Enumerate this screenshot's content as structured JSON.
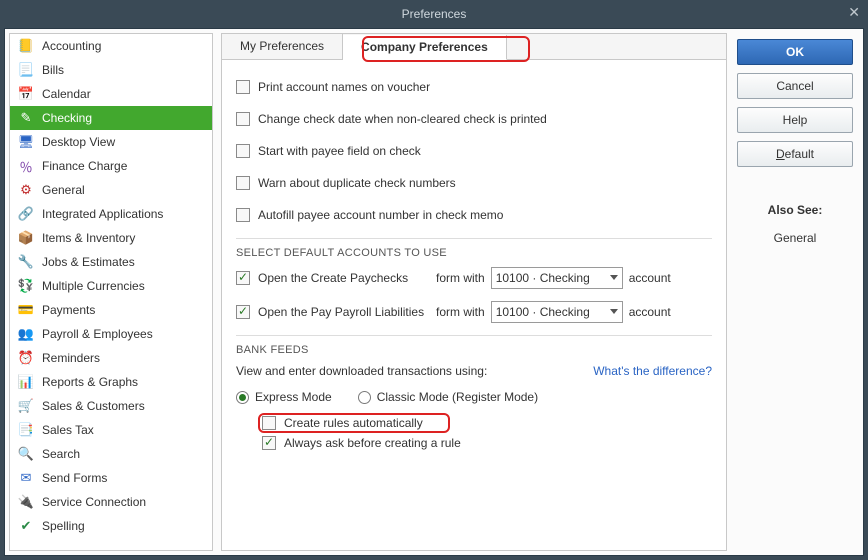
{
  "window_title": "Preferences",
  "sidebar": {
    "items": [
      {
        "label": "Accounting",
        "icon": "📒",
        "color": "#d08a1a"
      },
      {
        "label": "Bills",
        "icon": "📃",
        "color": "#2a64c4"
      },
      {
        "label": "Calendar",
        "icon": "📅",
        "color": "#2a64c4"
      },
      {
        "label": "Checking",
        "icon": "✎",
        "color": "#ffffff",
        "selected": true
      },
      {
        "label": "Desktop View",
        "icon": "🖥",
        "color": "#2a64c4"
      },
      {
        "label": "Finance Charge",
        "icon": "％",
        "color": "#7a3ea6"
      },
      {
        "label": "General",
        "icon": "⚙",
        "color": "#c02a2a"
      },
      {
        "label": "Integrated Applications",
        "icon": "🔗",
        "color": "#3a7aa6"
      },
      {
        "label": "Items & Inventory",
        "icon": "📦",
        "color": "#c28a2a"
      },
      {
        "label": "Jobs & Estimates",
        "icon": "🔧",
        "color": "#c28a2a"
      },
      {
        "label": "Multiple Currencies",
        "icon": "💱",
        "color": "#2a8a46"
      },
      {
        "label": "Payments",
        "icon": "💳",
        "color": "#2a8a46"
      },
      {
        "label": "Payroll & Employees",
        "icon": "👥",
        "color": "#2a8a46"
      },
      {
        "label": "Reminders",
        "icon": "⏰",
        "color": "#d0a22a"
      },
      {
        "label": "Reports & Graphs",
        "icon": "📊",
        "color": "#2a8a46"
      },
      {
        "label": "Sales & Customers",
        "icon": "🛒",
        "color": "#c26a2a"
      },
      {
        "label": "Sales Tax",
        "icon": "📑",
        "color": "#c26a2a"
      },
      {
        "label": "Search",
        "icon": "🔍",
        "color": "#555"
      },
      {
        "label": "Send Forms",
        "icon": "✉",
        "color": "#2a64c4"
      },
      {
        "label": "Service Connection",
        "icon": "🔌",
        "color": "#2a8a46"
      },
      {
        "label": "Spelling",
        "icon": "✔",
        "color": "#2a8a46"
      }
    ]
  },
  "tabs": {
    "my_prefs": "My Preferences",
    "company_prefs": "Company Preferences"
  },
  "checks": {
    "print_voucher": "Print account names on voucher",
    "change_date": "Change check date when non-cleared check is printed",
    "start_payee": "Start with payee field on check",
    "warn_dup": "Warn about duplicate check numbers",
    "autofill": "Autofill payee account number in check memo"
  },
  "section_accounts": "SELECT DEFAULT ACCOUNTS TO USE",
  "accounts": {
    "paychecks_label": "Open the Create Paychecks",
    "liabilities_label": "Open the Pay Payroll Liabilities",
    "form_with": "form with",
    "account_word": "account",
    "dropdown_value": "10100 · Checking"
  },
  "section_bank": "BANK FEEDS",
  "bank": {
    "view_enter": "View and enter downloaded transactions using:",
    "whats_diff": "What's the difference?",
    "express": "Express Mode",
    "classic": "Classic Mode (Register Mode)",
    "create_rules": "Create rules automatically",
    "always_ask": "Always ask before creating a rule"
  },
  "buttons": {
    "ok": "OK",
    "cancel": "Cancel",
    "help": "Help",
    "default_": "Default"
  },
  "also_see": {
    "header": "Also See:",
    "item": "General"
  }
}
